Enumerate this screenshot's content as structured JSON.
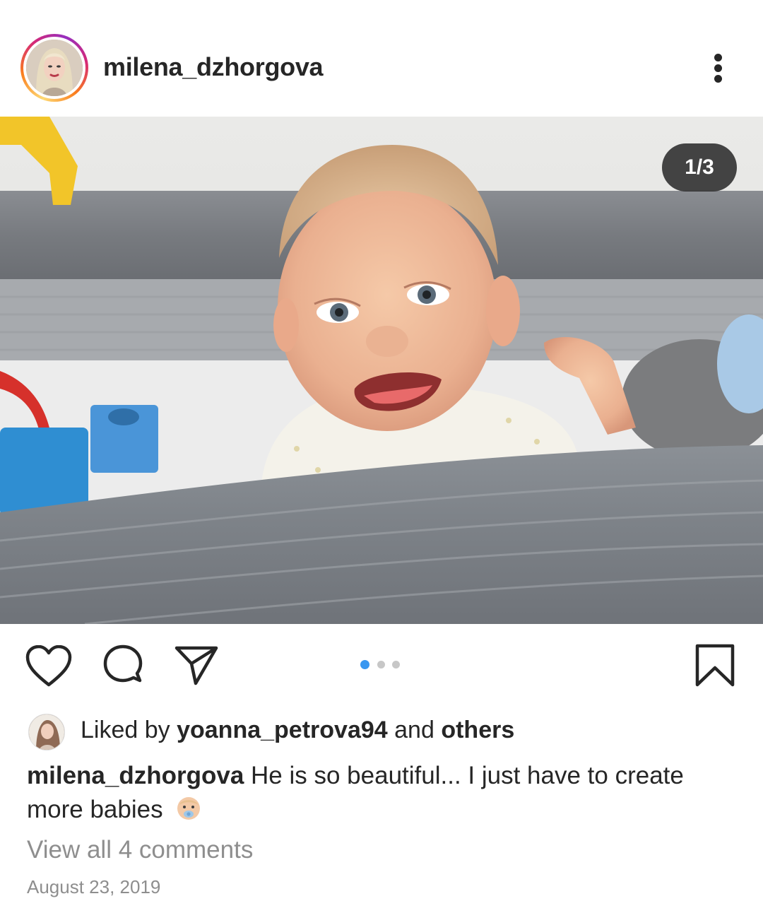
{
  "post": {
    "username": "milena_dzhorgova",
    "avatar_icon": "profile-photo",
    "menu_icon": "more-vertical-icon"
  },
  "media": {
    "counter": "1/3",
    "current_index": 1,
    "total": 3,
    "image_description_icon": "baby-photo"
  },
  "actions": {
    "like_icon": "heart-icon",
    "comment_icon": "comment-icon",
    "share_icon": "send-icon",
    "save_icon": "bookmark-icon"
  },
  "likes": {
    "prefix": "Liked by",
    "user": "yoanna_petrova94",
    "joiner": "and",
    "suffix": "others"
  },
  "caption": {
    "username": "milena_dzhorgova",
    "text": "He is so beautiful... I just have to create more babies",
    "emoji_icon": "baby-emoji-icon"
  },
  "comments_link": "View all 4 comments",
  "date": "August 23, 2019",
  "colors": {
    "text": "#262626",
    "muted": "#8e8e8e",
    "accent": "#3897f0"
  }
}
